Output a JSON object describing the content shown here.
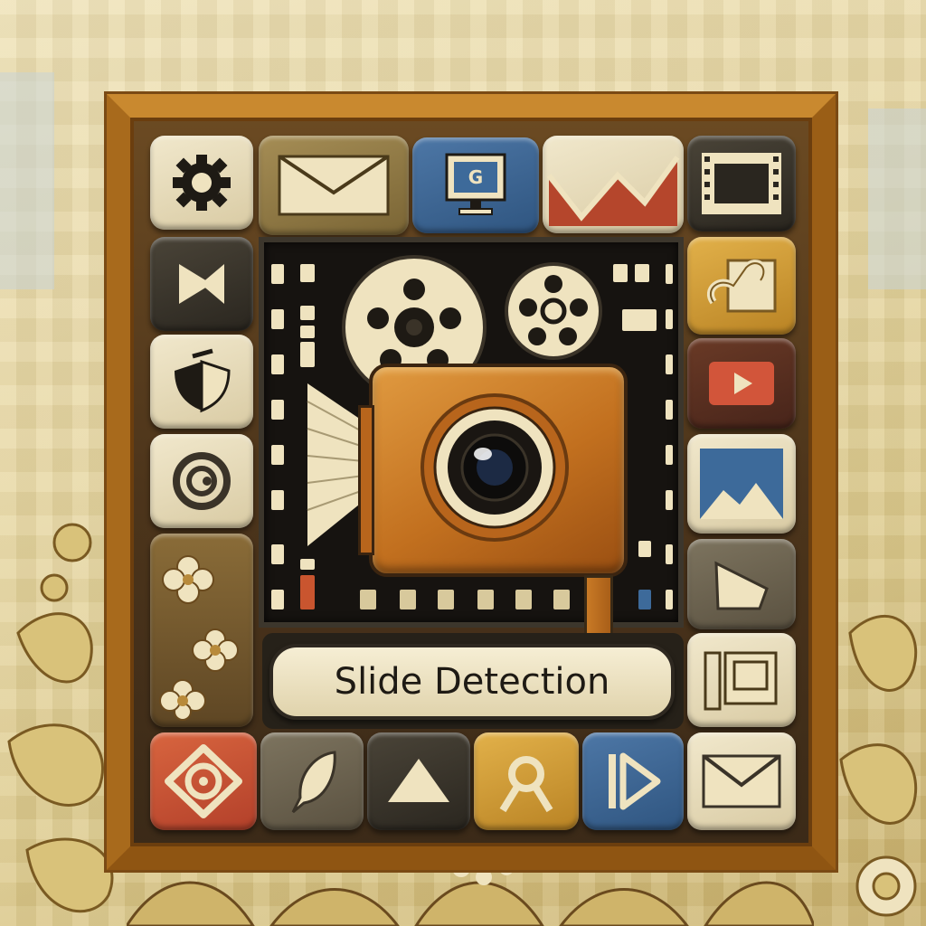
{
  "label": {
    "text": "Slide Detection"
  },
  "icons": {
    "top_row": [
      "gear-icon",
      "envelope-icon",
      "monitor-g-icon",
      "mountain-chart-icon",
      "film-frame-icon"
    ],
    "left_column": [
      "play-skip-icon",
      "shield-half-icon",
      "circle-g-icon"
    ],
    "right_column": [
      "link-tile-icon",
      "play-button-icon",
      "landscape-image-icon",
      "triangle-icon",
      "film-doc-icon"
    ],
    "bottom_row": [
      "target-icon",
      "quill-icon",
      "triangle-play-icon",
      "person-search-icon",
      "play-outline-icon",
      "mail-icon"
    ],
    "center": [
      "film-reel-icon",
      "film-reel-small-icon",
      "camera-icon",
      "film-strip-icon"
    ]
  },
  "colors": {
    "frame": "#b8741f",
    "camera": "#c97a26",
    "panel": "#161310",
    "label_bg": "#f6eed4"
  },
  "glyph_text": {
    "monitor_letter": "G"
  }
}
